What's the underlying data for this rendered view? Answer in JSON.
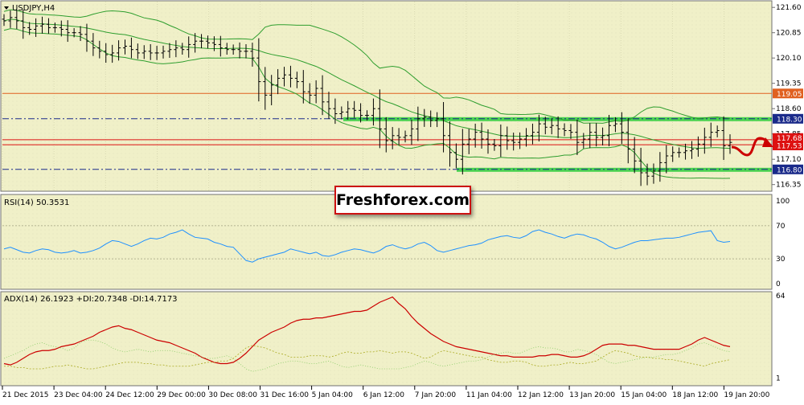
{
  "symbol_label": "USDJPY,H4",
  "watermark": "Freshforex.com",
  "colors": {
    "background": "#ffffff",
    "panel_background": "#f0f0c8",
    "grid": "#c8c8a0",
    "candle": "#000000",
    "bands": "#2e9e2e",
    "resistance_line": "#e06020",
    "level_line": "#1a2a8a",
    "zone": "#22cc33",
    "rsi": "#1e90ff",
    "adx": "#cc0000",
    "plus_di": "#88cc66",
    "minus_di": "#aaaa22",
    "forecast": "#cc0000",
    "price_tag_red": "#dd1111",
    "price_tag_blue": "#1a2a8a",
    "price_tag_orange": "#e06020"
  },
  "icons": {
    "symbol": "triangle-down-icon",
    "forecast": "curved-arrow-icon"
  },
  "chart_data": [
    {
      "type": "line",
      "title": "USDJPY,H4",
      "ylim": [
        116.2,
        121.7
      ],
      "yticks": [
        "121.60",
        "120.85",
        "120.10",
        "119.35",
        "118.60",
        "117.85",
        "117.10",
        "116.35"
      ],
      "x_labels": [
        "21 Dec 2015",
        "23 Dec 04:00",
        "24 Dec 12:00",
        "29 Dec 00:00",
        "30 Dec 08:00",
        "31 Dec 16:00",
        "5 Jan 04:00",
        "6 Jan 12:00",
        "7 Jan 20:00",
        "11 Jan 04:00",
        "12 Jan 12:00",
        "13 Jan 20:00",
        "15 Jan 04:00",
        "18 Jan 12:00",
        "19 Jan 20:00"
      ],
      "bar_count": 115,
      "series": [
        {
          "values": [
            121.2,
            121.3,
            121.2,
            121.0,
            120.95,
            121.05,
            121.1,
            121.0,
            121.0,
            120.95,
            120.85,
            120.85,
            120.8,
            120.6,
            120.4,
            120.3,
            120.2,
            120.25,
            120.4,
            120.45,
            120.35,
            120.25,
            120.3,
            120.25,
            120.25,
            120.3,
            120.35,
            120.4,
            120.35,
            120.5,
            120.6,
            120.6,
            120.55,
            120.5,
            120.4,
            120.35,
            120.35,
            120.3,
            120.3,
            120.1,
            119.4,
            119.0,
            119.3,
            119.5,
            119.6,
            119.5,
            119.4,
            119.1,
            119.0,
            119.2,
            118.8,
            118.6,
            118.45,
            118.5,
            118.6,
            118.55,
            118.4,
            118.4,
            118.6,
            118.0,
            117.65,
            117.8,
            117.75,
            117.8,
            118.0,
            118.3,
            118.35,
            118.25,
            118.3,
            117.8,
            117.3,
            117.1,
            117.55,
            117.7,
            117.9,
            117.7,
            117.55,
            117.5,
            117.8,
            117.65,
            117.6,
            117.7,
            117.8,
            117.9,
            118.15,
            118.05,
            118.1,
            118.0,
            117.95,
            117.9,
            117.6,
            117.7,
            117.9,
            117.75,
            117.8,
            118.1,
            118.15,
            117.9,
            117.4,
            117.05,
            116.7,
            116.6,
            116.75,
            117.0,
            117.2,
            117.3,
            117.3,
            117.35,
            117.4,
            117.55,
            117.75,
            117.9,
            117.95,
            117.5,
            117.6
          ]
        }
      ],
      "annotations": {
        "zones": [
          "118.30",
          "116.80"
        ],
        "resistance": "119.05",
        "current_lines": [
          "117.68",
          "117.53"
        ]
      }
    },
    {
      "type": "line",
      "title": "RSI(14) 50.3531",
      "ylim": [
        0,
        100
      ],
      "yticks": [
        "100",
        "70",
        "30",
        "0"
      ],
      "series": [
        {
          "values": [
            42,
            44,
            41,
            38,
            37,
            40,
            42,
            41,
            38,
            37,
            38,
            40,
            37,
            38,
            40,
            43,
            48,
            52,
            51,
            48,
            45,
            48,
            52,
            55,
            54,
            56,
            60,
            62,
            65,
            60,
            56,
            55,
            54,
            50,
            48,
            45,
            44,
            36,
            28,
            26,
            30,
            32,
            34,
            36,
            38,
            42,
            40,
            38,
            36,
            38,
            34,
            33,
            35,
            38,
            40,
            42,
            41,
            39,
            37,
            40,
            45,
            47,
            44,
            42,
            44,
            48,
            50,
            46,
            40,
            38,
            40,
            42,
            44,
            46,
            47,
            49,
            53,
            55,
            57,
            58,
            56,
            55,
            58,
            63,
            65,
            62,
            60,
            57,
            55,
            58,
            60,
            59,
            56,
            54,
            50,
            45,
            42,
            44,
            47,
            50,
            52,
            52,
            53,
            54,
            55,
            55,
            56,
            58,
            60,
            62,
            63,
            64,
            52,
            50,
            51
          ]
        }
      ]
    },
    {
      "type": "line",
      "title": "ADX(14) 26.1923 +DI:20.7348 -DI:14.7173",
      "ylim": [
        0,
        64
      ],
      "yticks": [
        "64",
        "1"
      ],
      "series": [
        {
          "values": [
            12,
            11,
            13,
            16,
            19,
            21,
            22,
            22,
            23,
            25,
            26,
            27,
            29,
            31,
            33,
            36,
            38,
            40,
            41,
            39,
            38,
            36,
            34,
            32,
            30,
            29,
            28,
            26,
            24,
            22,
            20,
            17,
            15,
            13,
            12,
            12,
            13,
            16,
            20,
            25,
            30,
            33,
            36,
            38,
            40,
            43,
            45,
            46,
            46,
            47,
            47,
            48,
            49,
            50,
            51,
            52,
            52,
            53,
            56,
            59,
            61,
            63,
            58,
            54,
            48,
            43,
            39,
            35,
            32,
            29,
            27,
            25,
            24,
            23,
            22,
            21,
            20,
            19,
            18,
            18,
            17,
            17,
            17,
            17,
            18,
            18,
            19,
            19,
            18,
            17,
            17,
            18,
            20,
            23,
            26,
            27,
            27,
            27,
            26,
            26,
            25,
            24,
            23,
            23,
            23,
            23,
            23,
            25,
            27,
            30,
            32,
            30,
            28,
            26,
            25
          ]
        },
        {
          "values": [
            16,
            18,
            20,
            22,
            25,
            27,
            28,
            26,
            25,
            24,
            22,
            24,
            28,
            30,
            30,
            29,
            27,
            24,
            22,
            21,
            22,
            23,
            22,
            21,
            22,
            22,
            22,
            21,
            20,
            19,
            18,
            17,
            16,
            16,
            17,
            18,
            16,
            12,
            8,
            6,
            7,
            8,
            10,
            12,
            13,
            14,
            14,
            13,
            12,
            12,
            13,
            14,
            12,
            10,
            9,
            10,
            11,
            10,
            9,
            8,
            8,
            8,
            8,
            9,
            10,
            12,
            14,
            13,
            11,
            10,
            11,
            12,
            13,
            14,
            14,
            15,
            17,
            19,
            20,
            21,
            20,
            20,
            22,
            24,
            25,
            24,
            24,
            23,
            21,
            21,
            23,
            22,
            21,
            19,
            16,
            13,
            12,
            13,
            14,
            15,
            16,
            17,
            17,
            18,
            19,
            19,
            20,
            22,
            24,
            27,
            28,
            26,
            24,
            22,
            21
          ]
        },
        {
          "values": [
            10,
            10,
            9,
            9,
            8,
            8,
            8,
            9,
            10,
            10,
            11,
            10,
            9,
            8,
            8,
            9,
            10,
            11,
            12,
            13,
            13,
            13,
            12,
            12,
            11,
            11,
            10,
            10,
            10,
            10,
            11,
            12,
            13,
            13,
            14,
            14,
            16,
            20,
            24,
            26,
            25,
            24,
            22,
            20,
            19,
            17,
            17,
            17,
            18,
            18,
            18,
            17,
            18,
            20,
            21,
            20,
            20,
            21,
            21,
            22,
            21,
            20,
            21,
            21,
            20,
            18,
            16,
            17,
            20,
            22,
            21,
            20,
            19,
            18,
            17,
            17,
            15,
            14,
            13,
            13,
            14,
            14,
            13,
            11,
            10,
            10,
            11,
            11,
            12,
            13,
            12,
            12,
            13,
            14,
            17,
            20,
            22,
            21,
            20,
            18,
            17,
            17,
            16,
            16,
            15,
            15,
            14,
            13,
            12,
            11,
            10,
            12,
            13,
            14,
            15
          ]
        }
      ]
    }
  ]
}
